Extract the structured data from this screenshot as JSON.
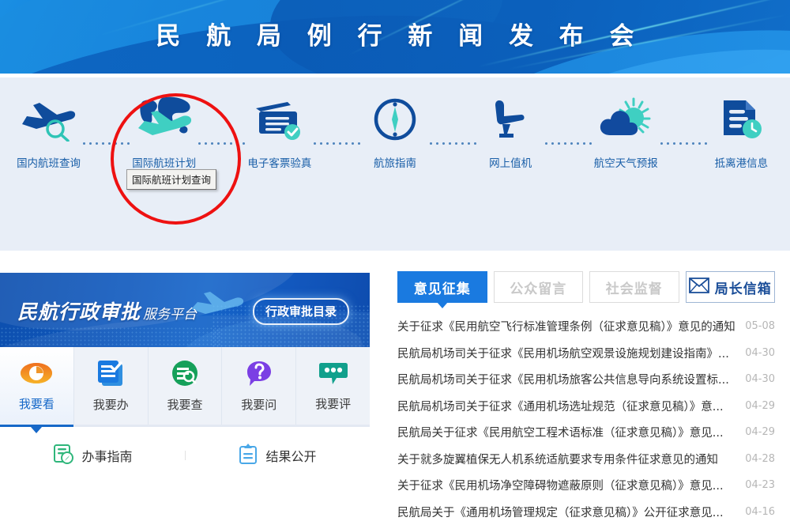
{
  "banner": {
    "title": "民 航 局 例 行 新 闻 发 布 会"
  },
  "quick_links": {
    "items": [
      {
        "label": "国内航班查询",
        "icon": "plane-search-icon"
      },
      {
        "label": "国际航班计划\n查询",
        "label_line1": "国际航班计划",
        "label_line2": "查询",
        "icon": "globe-plane-icon"
      },
      {
        "label": "电子客票验真",
        "icon": "ticket-check-icon"
      },
      {
        "label": "航旅指南",
        "icon": "compass-icon"
      },
      {
        "label": "网上值机",
        "icon": "seat-icon"
      },
      {
        "label": "航空天气预报",
        "icon": "cloud-sun-icon"
      },
      {
        "label": "抵离港信息",
        "icon": "document-clock-icon"
      }
    ],
    "tooltip": "国际航班计划查询",
    "annotation_color": "#ee1111"
  },
  "promo": {
    "title_bold": "民航行政审批",
    "title_light": "服务平台",
    "button": "行政审批目录"
  },
  "service_tabs": {
    "items": [
      {
        "label": "我要看",
        "icon": "eye-clock-icon",
        "color": "#f0962a",
        "active": true
      },
      {
        "label": "我要办",
        "icon": "form-check-icon",
        "color": "#1a7ae0",
        "active": false
      },
      {
        "label": "我要查",
        "icon": "doc-search-icon",
        "color": "#15a05a",
        "active": false
      },
      {
        "label": "我要问",
        "icon": "question-bubble-icon",
        "color": "#7b3fe4",
        "active": false
      },
      {
        "label": "我要评",
        "icon": "comment-dots-icon",
        "color": "#11a08c",
        "active": false
      }
    ],
    "links": [
      {
        "label": "办事指南",
        "icon": "guide-icon",
        "color": "#2fb67b"
      },
      {
        "label": "结果公开",
        "icon": "clipboard-icon",
        "color": "#4aa8e8"
      }
    ]
  },
  "panel": {
    "tabs": [
      {
        "label": "意见征集",
        "active": true
      },
      {
        "label": "公众留言",
        "active": false
      },
      {
        "label": "社会监督",
        "active": false
      }
    ],
    "mail_tab": {
      "label": "局长信箱",
      "icon": "envelope-icon"
    },
    "news": [
      {
        "title": "关于征求《民用航空飞行标准管理条例（征求意见稿）》意见的通知",
        "date": "05-08"
      },
      {
        "title": "民航局机场司关于征求《民用机场航空观景设施规划建设指南》...",
        "date": "04-30"
      },
      {
        "title": "民航局机场司关于征求《民用机场旅客公共信息导向系统设置标...",
        "date": "04-30"
      },
      {
        "title": "民航局机场司关于征求《通用机场选址规范（征求意见稿）》意...",
        "date": "04-29"
      },
      {
        "title": "民航局关于征求《民用航空工程术语标准（征求意见稿）》意见...",
        "date": "04-29"
      },
      {
        "title": "关于就多旋翼植保无人机系统适航要求专用条件征求意见的通知",
        "date": "04-28"
      },
      {
        "title": "关于征求《民用机场净空障碍物遮蔽原则（征求意见稿）》意见...",
        "date": "04-23"
      },
      {
        "title": "民航局关于《通用机场管理规定（征求意见稿）》公开征求意见...",
        "date": "04-16"
      }
    ]
  }
}
